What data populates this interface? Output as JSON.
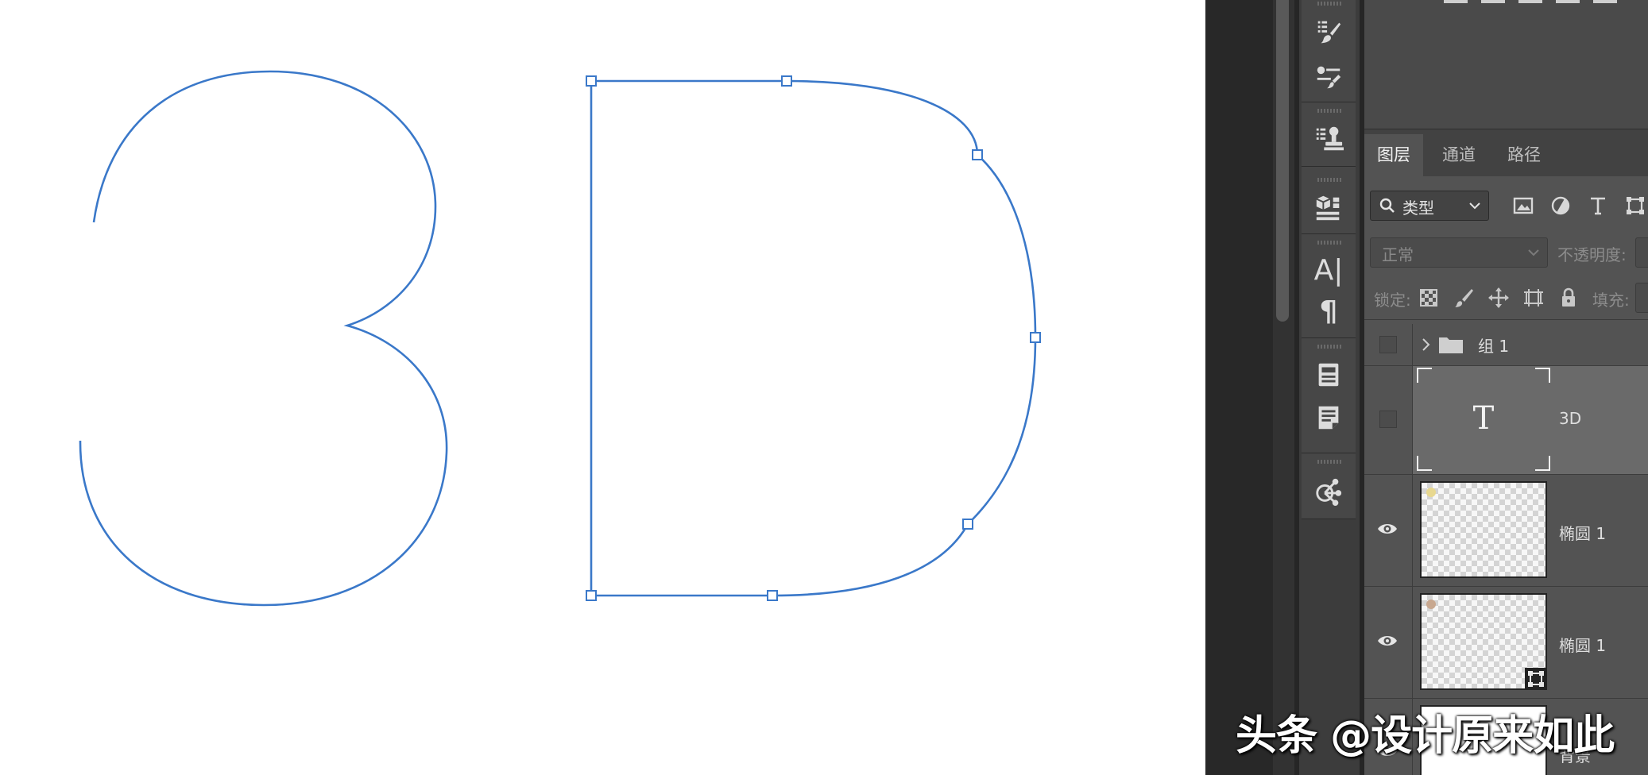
{
  "colors": {
    "path_stroke": "#3a78c9",
    "panel_bg": "#535353",
    "selected_layer_bg": "#6a6a6a"
  },
  "tools": [
    {
      "name": "brush-presets-icon"
    },
    {
      "name": "brush-settings-icon"
    },
    {
      "name": "clone-source-icon"
    },
    {
      "name": "3d-materials-icon"
    },
    {
      "name": "character-icon"
    },
    {
      "name": "paragraph-icon"
    },
    {
      "name": "character-styles-icon"
    },
    {
      "name": "paragraph-styles-icon"
    },
    {
      "name": "modifier-icon"
    }
  ],
  "tabs": [
    {
      "label": "图层",
      "active": true
    },
    {
      "label": "通道",
      "active": false
    },
    {
      "label": "路径",
      "active": false
    }
  ],
  "filter": {
    "kind_label": "类型"
  },
  "blend": {
    "mode": "正常",
    "opacity_label": "不透明度:"
  },
  "lock": {
    "label": "锁定:",
    "fill_label": "填充:"
  },
  "layers": [
    {
      "name": "组 1",
      "type": "group",
      "visible": false
    },
    {
      "name": "3D",
      "type": "text",
      "visible": false,
      "selected": true
    },
    {
      "name": "椭圆 1",
      "type": "shape",
      "visible": true
    },
    {
      "name": "椭圆 1",
      "type": "shape",
      "visible": true
    },
    {
      "name": "背景",
      "type": "background",
      "visible": true
    }
  ],
  "watermark": "头条 @设计原来如此"
}
